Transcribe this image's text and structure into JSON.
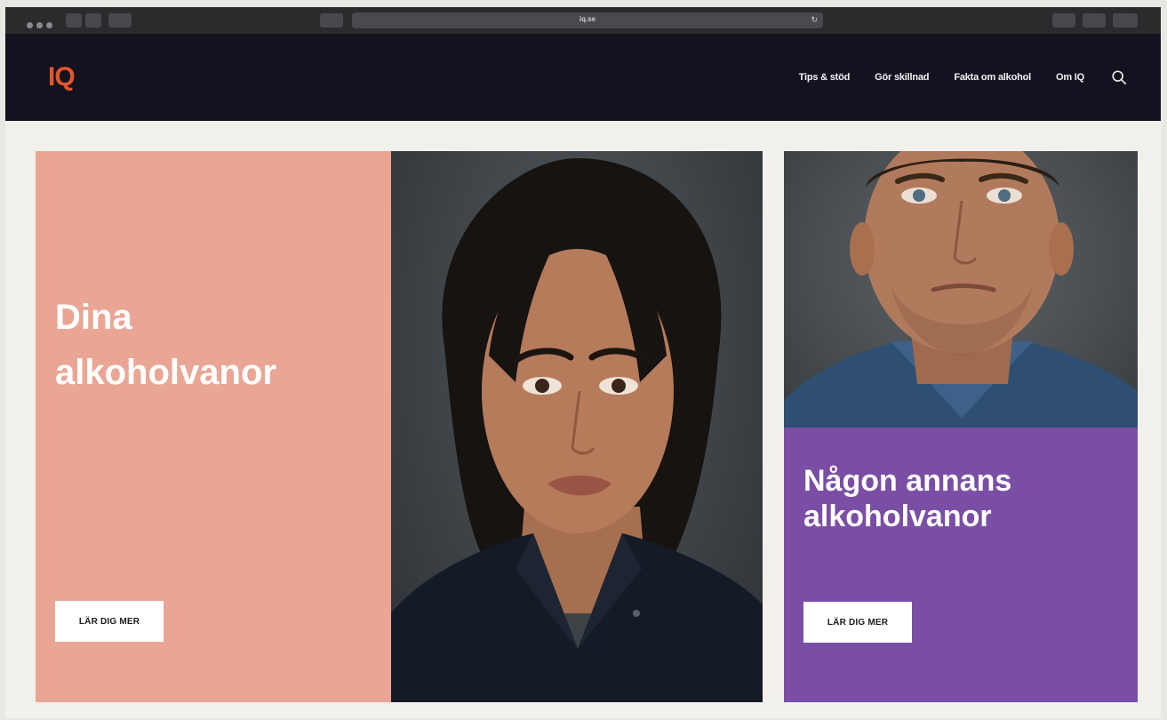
{
  "browser": {
    "url": "iq.se"
  },
  "header": {
    "logo_text": "IQ",
    "nav_items": [
      {
        "label": "Tips & stöd"
      },
      {
        "label": "Gör skillnad"
      },
      {
        "label": "Fakta om alkohol"
      },
      {
        "label": "Om IQ"
      }
    ],
    "search_icon": "search-icon"
  },
  "cards": [
    {
      "headline_line1": "Dina",
      "headline_line2": "alkoholvanor",
      "button_label": "LÄR DIG MER",
      "color": "#e9a695"
    },
    {
      "headline_line1": "Någon annans",
      "headline_line2": "alkoholvanor",
      "button_label": "LÄR DIG MER",
      "color": "#7a4ea5"
    }
  ],
  "colors": {
    "nav_background": "#14121f",
    "logo": "#e2562c",
    "page_background": "#f2f0eb"
  }
}
